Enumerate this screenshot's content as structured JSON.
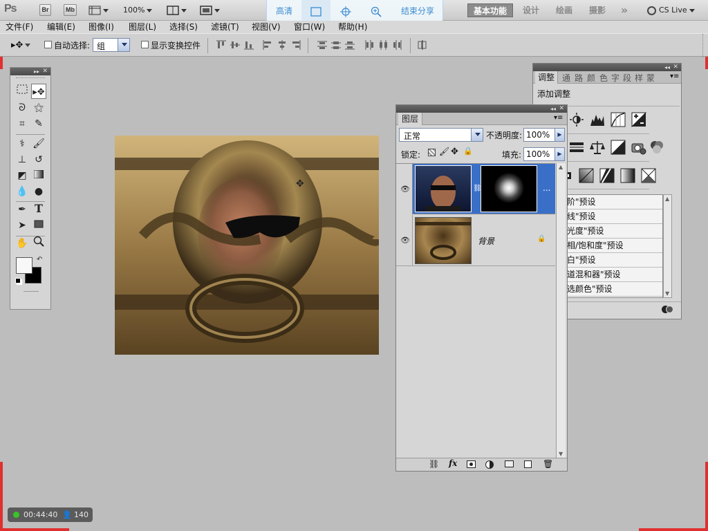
{
  "app": {
    "logo": "Ps",
    "bridge_label": "Br",
    "minibridge_label": "Mb",
    "zoom": "100%",
    "workspaces": [
      "基本功能",
      "设计",
      "绘画",
      "摄影"
    ],
    "overflow": "»",
    "cs_live": "CS Live"
  },
  "overlay_toolbar": {
    "items": [
      "高清",
      "",
      "",
      "",
      "结束分享"
    ]
  },
  "menubar": {
    "items": [
      "文件(F)",
      "编辑(E)",
      "图像(I)",
      "图层(L)",
      "选择(S)",
      "滤镜(T)",
      "视图(V)",
      "窗口(W)",
      "帮助(H)"
    ]
  },
  "options": {
    "auto_select_label": "自动选择:",
    "auto_select_value": "组",
    "show_transform_label": "显示变换控件"
  },
  "layers_panel": {
    "tab": "图层",
    "blend_mode": "正常",
    "opacity_label": "不透明度:",
    "opacity_value": "100%",
    "lock_label": "锁定:",
    "fill_label": "填充:",
    "fill_value": "100%",
    "layers": [
      {
        "name": "",
        "visible": true,
        "selected": true,
        "has_mask": true,
        "dots": "..."
      },
      {
        "name": "背景",
        "visible": true,
        "selected": false,
        "locked": true
      }
    ]
  },
  "adjust_panel": {
    "tabs": [
      "调整",
      "通",
      "路",
      "颜",
      "色",
      "字",
      "段",
      "样",
      "蒙"
    ],
    "heading": "添加调整",
    "presets": [
      "阶\"预设",
      "线\"预设",
      "光度\"预设",
      "相/饱和度\"预设",
      "白\"预设",
      "道混和器\"预设",
      "选颜色\"预设"
    ]
  },
  "status_badge": {
    "time": "00:44:40",
    "count": "140"
  },
  "colors": {
    "accent_blue": "#3a6fc8",
    "overlay_text": "#3a8bd0",
    "status_green": "#39c427",
    "corner_red": "#e03030"
  }
}
